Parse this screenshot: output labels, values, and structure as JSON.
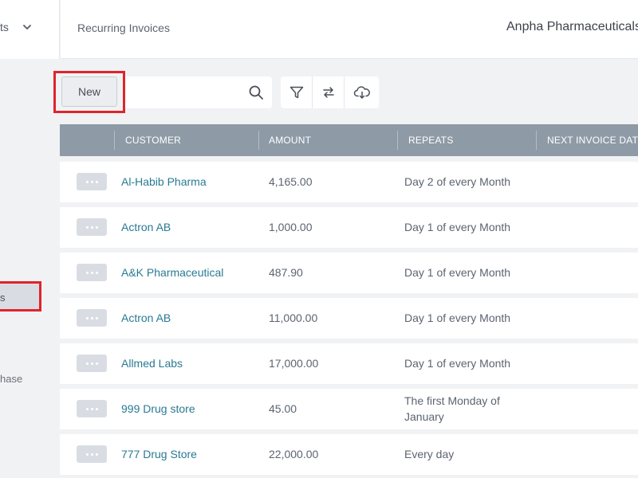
{
  "nav": {
    "menu_label": "ts",
    "breadcrumb": "Recurring Invoices",
    "org_name": "Anpha Pharmaceuticals",
    "sidebar_active_label": "s",
    "sidebar_purchase_label": "hase"
  },
  "toolbar": {
    "new_label": "New",
    "search_placeholder": "",
    "icons": [
      "filter-icon",
      "repeat-icon",
      "cloud-download-icon"
    ]
  },
  "table": {
    "columns": [
      "CUSTOMER",
      "AMOUNT",
      "REPEATS",
      "NEXT INVOICE DATE"
    ],
    "rows": [
      {
        "customer": "Al-Habib Pharma",
        "amount": "4,165.00",
        "repeats": "Day 2 of every Month"
      },
      {
        "customer": "Actron AB",
        "amount": "1,000.00",
        "repeats": "Day 1 of every Month"
      },
      {
        "customer": "A&K Pharmaceutical",
        "amount": "487.90",
        "repeats": "Day 1 of every Month"
      },
      {
        "customer": "Actron AB",
        "amount": "11,000.00",
        "repeats": "Day 1 of every Month"
      },
      {
        "customer": "Allmed Labs",
        "amount": "17,000.00",
        "repeats": "Day 1 of every Month"
      },
      {
        "customer": "999 Drug store",
        "amount": "45.00",
        "repeats": "The first Monday of January"
      },
      {
        "customer": "777 Drug Store",
        "amount": "22,000.00",
        "repeats": "Every day"
      }
    ]
  },
  "colors": {
    "header_bg": "#8e9aa6",
    "link": "#2a7a93",
    "highlight": "#e0242a"
  }
}
